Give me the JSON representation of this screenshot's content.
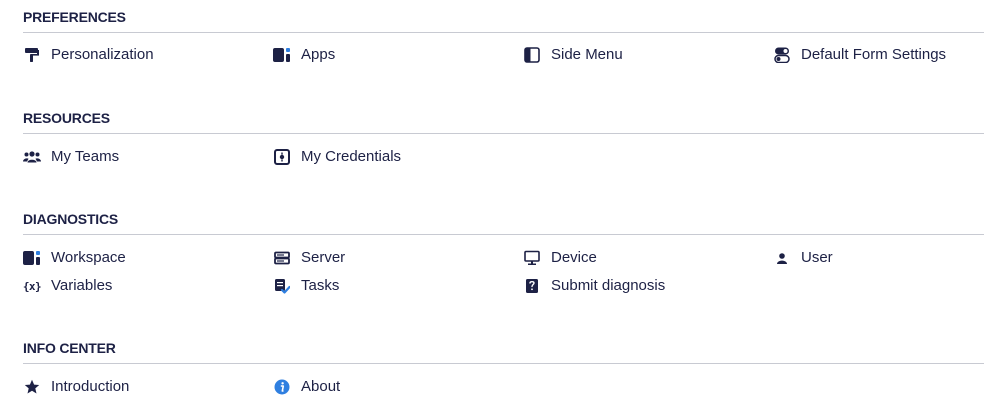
{
  "sections": {
    "preferences": {
      "title": "PREFERENCES",
      "items": [
        {
          "label": "Personalization",
          "icon": "paint-roller-icon"
        },
        {
          "label": "Apps",
          "icon": "apps-icon"
        },
        {
          "label": "Side Menu",
          "icon": "side-menu-icon"
        },
        {
          "label": "Default Form Settings",
          "icon": "toggle-settings-icon"
        }
      ]
    },
    "resources": {
      "title": "RESOURCES",
      "items": [
        {
          "label": "My Teams",
          "icon": "users-icon"
        },
        {
          "label": "My Credentials",
          "icon": "credentials-safe-icon"
        }
      ]
    },
    "diagnostics": {
      "title": "DIAGNOSTICS",
      "items": [
        {
          "label": "Workspace",
          "icon": "workspace-icon"
        },
        {
          "label": "Server",
          "icon": "server-icon"
        },
        {
          "label": "Device",
          "icon": "monitor-icon"
        },
        {
          "label": "User",
          "icon": "user-icon"
        },
        {
          "label": "Variables",
          "icon": "variables-icon",
          "glyph": "{x}"
        },
        {
          "label": "Tasks",
          "icon": "tasks-icon"
        },
        {
          "label": "Submit diagnosis",
          "icon": "submit-diagnosis-icon"
        }
      ]
    },
    "info_center": {
      "title": "INFO CENTER",
      "items": [
        {
          "label": "Introduction",
          "icon": "star-icon"
        },
        {
          "label": "About",
          "icon": "info-icon"
        }
      ]
    }
  },
  "colors": {
    "text": "#1d2145",
    "divider": "#c8cad2",
    "accent": "#2f7fe0"
  }
}
